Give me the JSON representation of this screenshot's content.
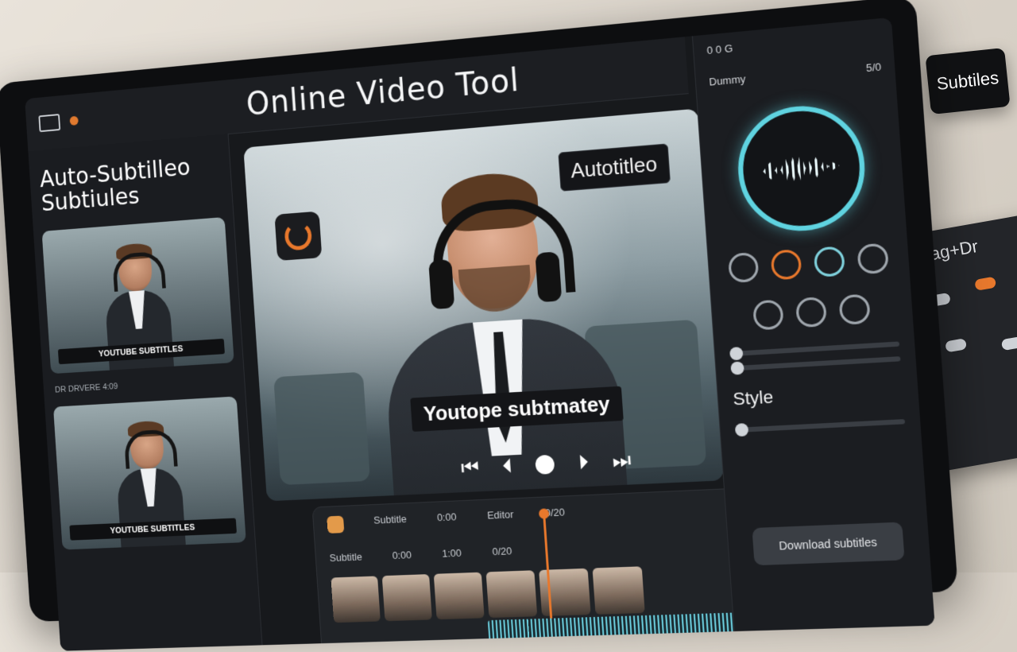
{
  "app": {
    "title": "Online Video Tool"
  },
  "sidebar": {
    "title_line1": "Auto-Subtilleo",
    "title_line2": "Subtiules",
    "cards": [
      {
        "caption": "YOUTUBE SUBTITLES",
        "meta": "DR   DRVERE   4:09"
      },
      {
        "caption": "YOUTUBE SUBTITLES",
        "meta": ""
      }
    ]
  },
  "player": {
    "badge": "Autotitleo",
    "subtitle": "Youtope subtmatey",
    "controls": {
      "prev": "⏮",
      "back": "⏴",
      "next": "⏭",
      "skip": "⏵"
    }
  },
  "timeline": {
    "row1": [
      "Subtitle",
      "0:00",
      "Editor",
      "0/20"
    ],
    "row2": [
      "Subtitle",
      "0:00",
      "1:00",
      "0/20"
    ]
  },
  "right_panel": {
    "row1_label": "0 0 G",
    "row2_label": "Dummy",
    "row2_value": "5/0",
    "style_label": "Style",
    "bottom_button": "Download subtitles"
  },
  "desk": {
    "sticker_text": "Subtiles",
    "device_label": "Drag+Dr"
  },
  "colors": {
    "accent_orange": "#e8782c",
    "accent_cyan": "#5fd3e0",
    "panel_bg": "#1b1d21"
  }
}
